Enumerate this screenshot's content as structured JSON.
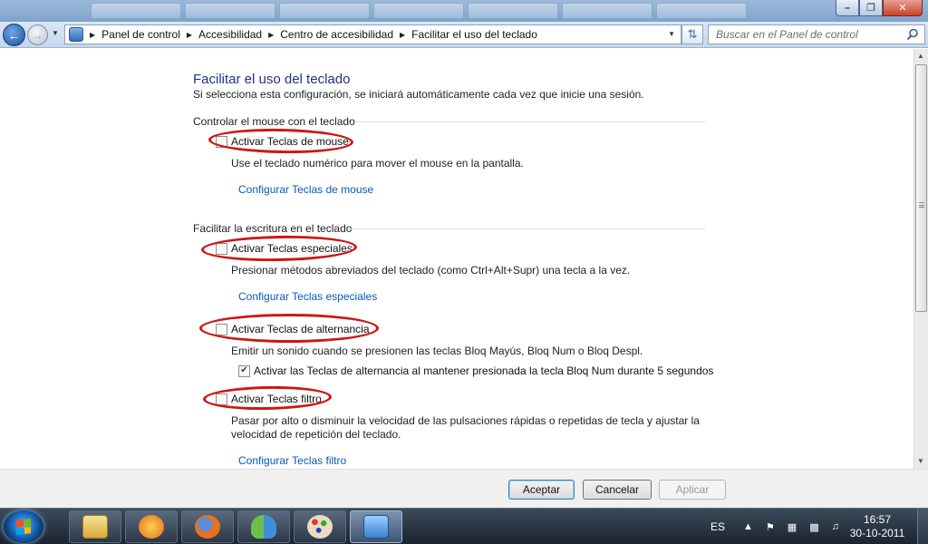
{
  "window": {
    "minimize_glyph": "–",
    "maximize_glyph": "❐",
    "close_glyph": "✕"
  },
  "address_bar": {
    "breadcrumbs": [
      "Panel de control",
      "Accesibilidad",
      "Centro de accesibilidad",
      "Facilitar el uso del teclado"
    ],
    "search_placeholder": "Buscar en el Panel de control"
  },
  "page": {
    "title": "Facilitar el uso del teclado",
    "description": "Si selecciona esta configuración, se iniciará automáticamente cada vez que inicie una sesión.",
    "sections": [
      {
        "heading": "Controlar el mouse con el teclado",
        "mouse_keys": {
          "label": "Activar Teclas de mouse",
          "checked": false,
          "description": "Use el teclado numérico para mover el mouse en la pantalla.",
          "link": "Configurar Teclas de mouse"
        }
      },
      {
        "heading": "Facilitar la escritura en el teclado",
        "sticky_keys": {
          "label": "Activar Teclas especiales",
          "checked": false,
          "description": "Presionar métodos abreviados del teclado (como Ctrl+Alt+Supr) una tecla a la vez.",
          "link": "Configurar Teclas especiales"
        },
        "toggle_keys": {
          "label": "Activar Teclas de alternancia",
          "checked": false,
          "description": "Emitir un sonido cuando se presionen las teclas Bloq Mayús, Bloq Num o Bloq Despl.",
          "sub_option": {
            "label": "Activar las Teclas de alternancia al mantener presionada la tecla Bloq Num durante 5 segundos",
            "checked": true
          }
        },
        "filter_keys": {
          "label": "Activar Teclas filtro",
          "checked": false,
          "description_line1": "Pasar por alto o disminuir la velocidad de las pulsaciones rápidas o repetidas de tecla y ajustar la",
          "description_line2": "velocidad de repetición del teclado.",
          "link": "Configurar Teclas filtro"
        }
      }
    ]
  },
  "buttons": {
    "accept": "Aceptar",
    "cancel": "Cancelar",
    "apply": "Aplicar"
  },
  "taskbar": {
    "apps": [
      "windows-explorer",
      "media-player",
      "firefox",
      "messenger",
      "paint",
      "control-panel"
    ],
    "language": "ES",
    "time": "16:57",
    "date": "30-10-2011"
  },
  "colors": {
    "title_blue": "#1e3287",
    "link_blue": "#0a59b4",
    "highlight_red": "#cc1717"
  }
}
